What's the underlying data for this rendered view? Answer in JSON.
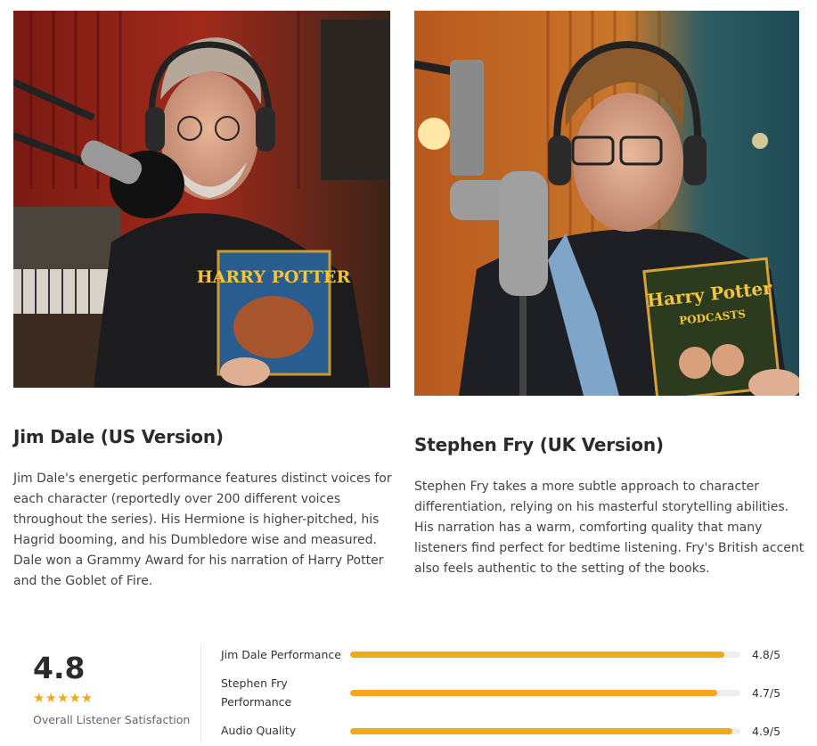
{
  "profiles": [
    {
      "name": "Jim Dale (US Version)",
      "description": "Jim Dale's energetic performance features distinct voices for each character (reportedly over 200 different voices throughout the series). His Hermione is higher-pitched, his Hagrid booming, and his Dumbledore wise and measured. Dale won a Grammy Award for his narration of Harry Potter and the Goblet of Fire.",
      "book_cover_text": "HARRY POTTER"
    },
    {
      "name": "Stephen Fry (UK Version)",
      "description": "Stephen Fry takes a more subtle approach to character differentiation, relying on his masterful storytelling abilities. His narration has a warm, comforting quality that many listeners find perfect for bedtime listening. Fry's British accent also feels authentic to the setting of the books.",
      "book_cover_text": "Harry Potter",
      "book_cover_subtext": "PODCASTS"
    }
  ],
  "summary": {
    "score": "4.8",
    "stars": "★★★★★",
    "label": "Overall Listener Satisfaction"
  },
  "ratings": [
    {
      "label": "Jim Dale Performance",
      "value": "4.8/5",
      "fraction": 0.96
    },
    {
      "label": "Stephen Fry Performance",
      "value": "4.7/5",
      "fraction": 0.94
    },
    {
      "label": "Audio Quality",
      "value": "4.9/5",
      "fraction": 0.98
    }
  ],
  "colors": {
    "accent": "#f2a81d",
    "track": "#eeeeee"
  }
}
